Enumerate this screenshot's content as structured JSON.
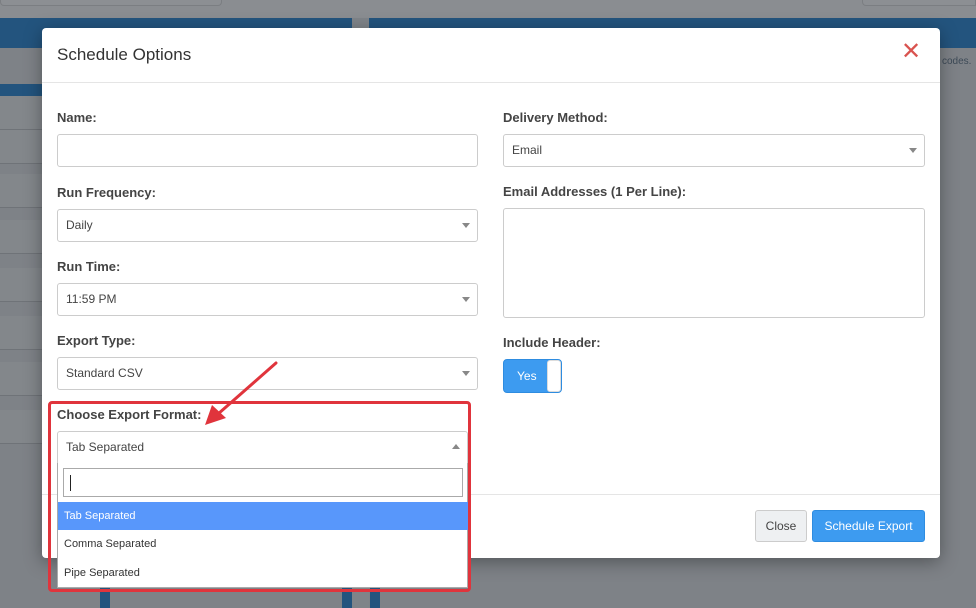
{
  "background": {
    "hint_text": "codes."
  },
  "modal": {
    "title": "Schedule Options",
    "close_icon": "close-icon",
    "left": {
      "name_label": "Name:",
      "name_value": "",
      "run_frequency_label": "Run Frequency:",
      "run_frequency_value": "Daily",
      "run_time_label": "Run Time:",
      "run_time_value": "11:59 PM",
      "export_type_label": "Export Type:",
      "export_type_value": "Standard CSV",
      "export_format_label": "Choose Export Format:",
      "export_format_value": "Tab Separated"
    },
    "right": {
      "delivery_method_label": "Delivery Method:",
      "delivery_method_value": "Email",
      "email_addresses_label": "Email Addresses (1 Per Line):",
      "email_addresses_value": "",
      "include_header_label": "Include Header:",
      "include_header_toggle": "Yes"
    },
    "dropdown": {
      "search_value": "",
      "options": [
        "Tab Separated",
        "Comma Separated",
        "Pipe Separated"
      ],
      "selected_index": 0
    },
    "footer": {
      "close_label": "Close",
      "schedule_label": "Schedule Export"
    }
  },
  "colors": {
    "accent": "#3d9bf0",
    "highlight": "#e0343c",
    "option_selected": "#5897fb",
    "close_icon": "#d9534f"
  }
}
